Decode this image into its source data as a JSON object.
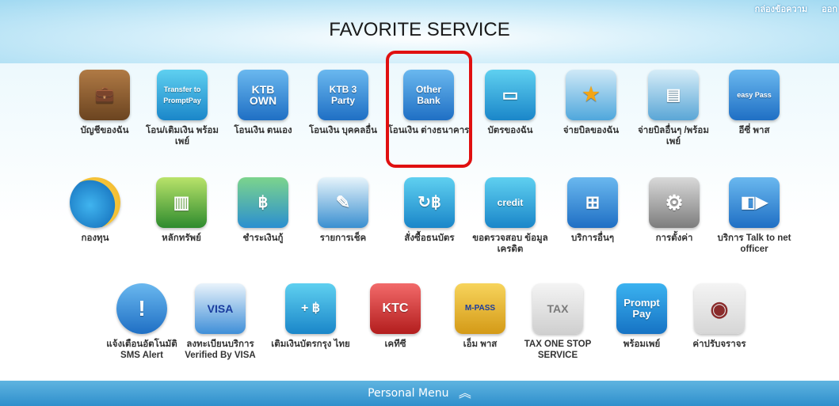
{
  "header": {
    "title": "FAVORITE SERVICE",
    "links": [
      "กล่องข้อความ",
      "ออก"
    ]
  },
  "tiles": [
    {
      "label": "บัญชีของฉัน",
      "icon": "wallet-icon",
      "text": "",
      "color": "#8a5a2b"
    },
    {
      "label": "โอน/เติมเงิน พร้อมเพย์",
      "icon": "transfer-promptpay-icon",
      "text": "Transfer to PromptPay"
    },
    {
      "label": "โอนเงิน ตนเอง",
      "icon": "transfer-own-icon",
      "text": "KTB OWN"
    },
    {
      "label": "โอนเงิน บุคคลอื่น",
      "icon": "transfer-3rd-party-icon",
      "text": "KTB 3 Party"
    },
    {
      "label": "โอนเงิน ต่างธนาคาร",
      "icon": "transfer-other-bank-icon",
      "text": "Other Bank"
    },
    {
      "label": "บัตรของฉัน",
      "icon": "card-icon",
      "text": ""
    },
    {
      "label": "จ่ายบิลของฉัน",
      "icon": "bill-star-icon",
      "text": ""
    },
    {
      "label": "จ่ายบิลอื่นๆ /พร้อมเพย์",
      "icon": "bill-other-icon",
      "text": ""
    },
    {
      "label": "อีซี่ พาส",
      "icon": "easy-pass-icon",
      "text": "easy Pass"
    },
    {
      "label": "กองทุน",
      "icon": "pie-chart-icon",
      "text": ""
    },
    {
      "label": "หลักทรัพย์",
      "icon": "bar-chart-icon",
      "text": ""
    },
    {
      "label": "ชำระเงินกู้",
      "icon": "loan-icon",
      "text": ""
    },
    {
      "label": "รายการเช็ค",
      "icon": "cheque-icon",
      "text": ""
    },
    {
      "label": "สั่งซื้อธนบัตร",
      "icon": "currency-exchange-icon",
      "text": ""
    },
    {
      "label": "ขอตรวจสอบ ข้อมูลเครดิต",
      "icon": "credit-check-icon",
      "text": "credit"
    },
    {
      "label": "บริการอื่นๆ",
      "icon": "other-services-icon",
      "text": ""
    },
    {
      "label": "การตั้งค่า",
      "icon": "settings-icon",
      "text": ""
    },
    {
      "label": "บริการ Talk to net officer",
      "icon": "video-call-icon",
      "text": ""
    },
    {
      "label": "แจ้งเตือนอัตโนมัติ SMS Alert",
      "icon": "alert-icon",
      "text": "!"
    },
    {
      "label": "ลงทะเบียนบริการ Verified By VISA",
      "icon": "visa-icon",
      "text": "VISA"
    },
    {
      "label": "เติมเงินบัตรกรุง ไทย",
      "icon": "topup-card-icon",
      "text": "+ ฿"
    },
    {
      "label": "เคทีซี",
      "icon": "ktc-icon",
      "text": "KTC"
    },
    {
      "label": "เอ็ม พาส",
      "icon": "m-pass-icon",
      "text": "M-PASS"
    },
    {
      "label": "TAX ONE STOP SERVICE",
      "icon": "tax-icon",
      "text": "TAX"
    },
    {
      "label": "พร้อมเพย์",
      "icon": "promptpay-icon",
      "text": "Prompt Pay"
    },
    {
      "label": "ค่าปรับจราจร",
      "icon": "traffic-fine-icon",
      "text": ""
    }
  ],
  "footer": {
    "label": "Personal Menu"
  }
}
